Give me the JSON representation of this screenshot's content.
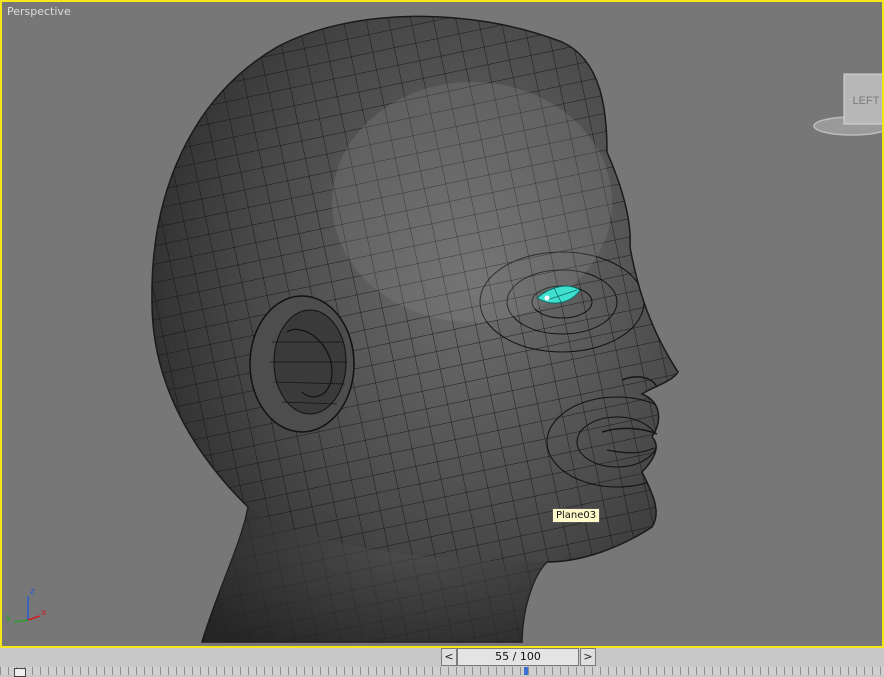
{
  "viewport": {
    "label": "Perspective",
    "tooltip": "Plane03"
  },
  "viewcube": {
    "face_label": "LEFT"
  },
  "axis": {
    "z": "z",
    "x": "x",
    "y": "y"
  },
  "timeline": {
    "frame_display": "55 / 100",
    "prev_label": "<",
    "next_label": ">"
  },
  "colors": {
    "viewport_border": "#f5e51a",
    "eye_selection": "#3fe0d0",
    "axis_x": "#d02020",
    "axis_z": "#2a5cd0",
    "axis_y": "#2aa02a"
  }
}
